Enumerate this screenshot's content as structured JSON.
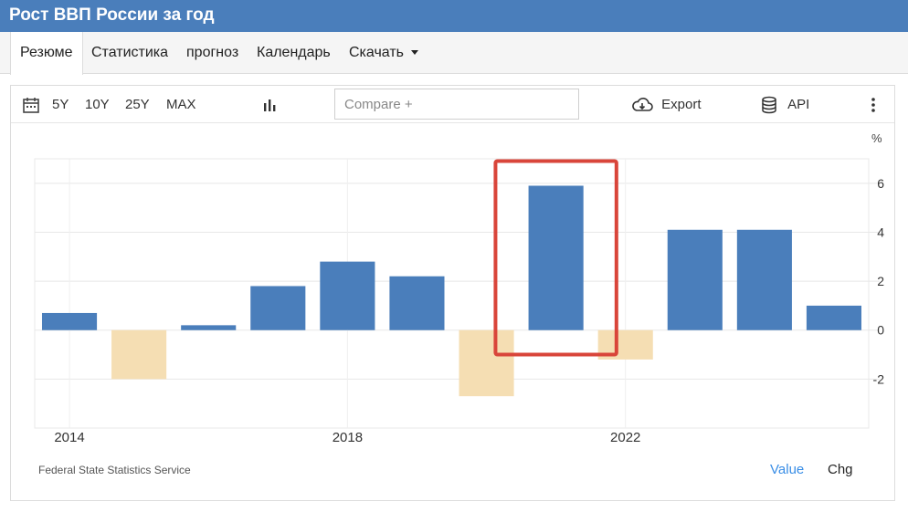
{
  "header": {
    "title": "Рост ВВП России за год"
  },
  "nav": {
    "tabs": [
      {
        "label": "Резюме"
      },
      {
        "label": "Статистика"
      },
      {
        "label": "прогноз"
      },
      {
        "label": "Календарь"
      },
      {
        "label": "Скачать"
      }
    ]
  },
  "toolbar": {
    "ranges": [
      "5Y",
      "10Y",
      "25Y",
      "MAX"
    ],
    "compare_placeholder": "Compare +",
    "export_label": "Export",
    "api_label": "API"
  },
  "footer": {
    "source": "Federal State Statistics Service",
    "value_label": "Value",
    "chg_label": "Chg"
  },
  "colors": {
    "accent": "#4a7ebb",
    "positive": "#4a7ebb",
    "negative": "#f5deb3",
    "highlight": "#d9453a",
    "link": "#3a8ee6"
  },
  "chart_data": {
    "type": "bar",
    "unit": "%",
    "categories": [
      "2014",
      "2015",
      "2016",
      "2017",
      "2018",
      "2019",
      "2020",
      "2021",
      "2022",
      "2023",
      "2024",
      "2025"
    ],
    "values": [
      0.7,
      -2.0,
      0.2,
      1.8,
      2.8,
      2.2,
      -2.7,
      5.9,
      -1.2,
      4.1,
      4.1,
      1.0
    ],
    "x_tick_labels": [
      "2014",
      "2018",
      "2022"
    ],
    "y_ticks": [
      -2,
      0,
      2,
      4,
      6
    ],
    "ylim": [
      -4,
      7
    ],
    "highlighted_category": "2021",
    "grid": true
  }
}
